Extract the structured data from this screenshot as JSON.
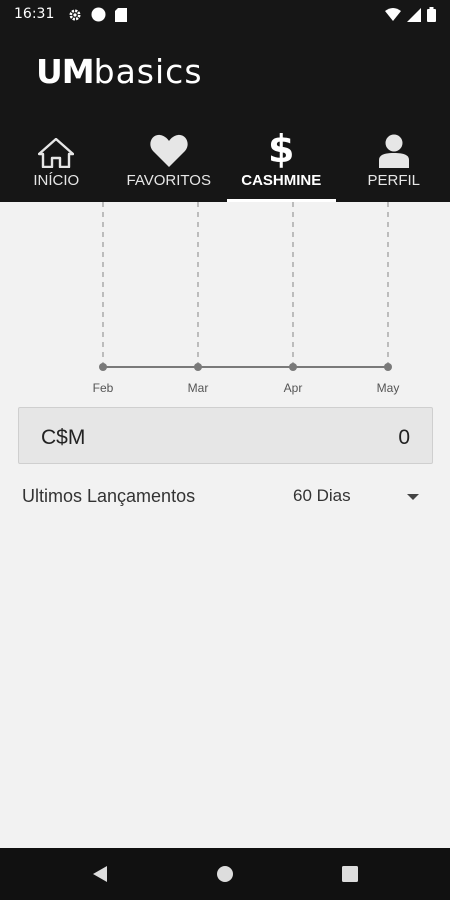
{
  "status_bar": {
    "time": "16:31",
    "left_icons": [
      "gear-icon",
      "circle-icon",
      "sd-card-icon"
    ],
    "right_icons": [
      "wifi-icon",
      "signal-icon",
      "battery-icon"
    ]
  },
  "app": {
    "logo_um": "UM",
    "logo_basics": "basics"
  },
  "tabs": [
    {
      "label": "INÍCIO",
      "icon": "home-icon",
      "active": false
    },
    {
      "label": "FAVORITOS",
      "icon": "heart-icon",
      "active": false
    },
    {
      "label": "CASHMINE",
      "icon": "dollar-icon",
      "active": true
    },
    {
      "label": "PERFIL",
      "icon": "user-icon",
      "active": false
    }
  ],
  "chart_data": {
    "type": "line",
    "categories": [
      "Feb",
      "Mar",
      "Apr",
      "May"
    ],
    "values": [
      0,
      0,
      0,
      0
    ],
    "title": "",
    "xlabel": "",
    "ylabel": "",
    "grid": "vertical-dashed"
  },
  "balance": {
    "currency": "C$M",
    "amount": "0"
  },
  "recent": {
    "title": "Ultimos Lançamentos",
    "period_selected": "60 Dias"
  },
  "navbar": [
    "back-icon",
    "home-circle-icon",
    "recents-icon"
  ]
}
